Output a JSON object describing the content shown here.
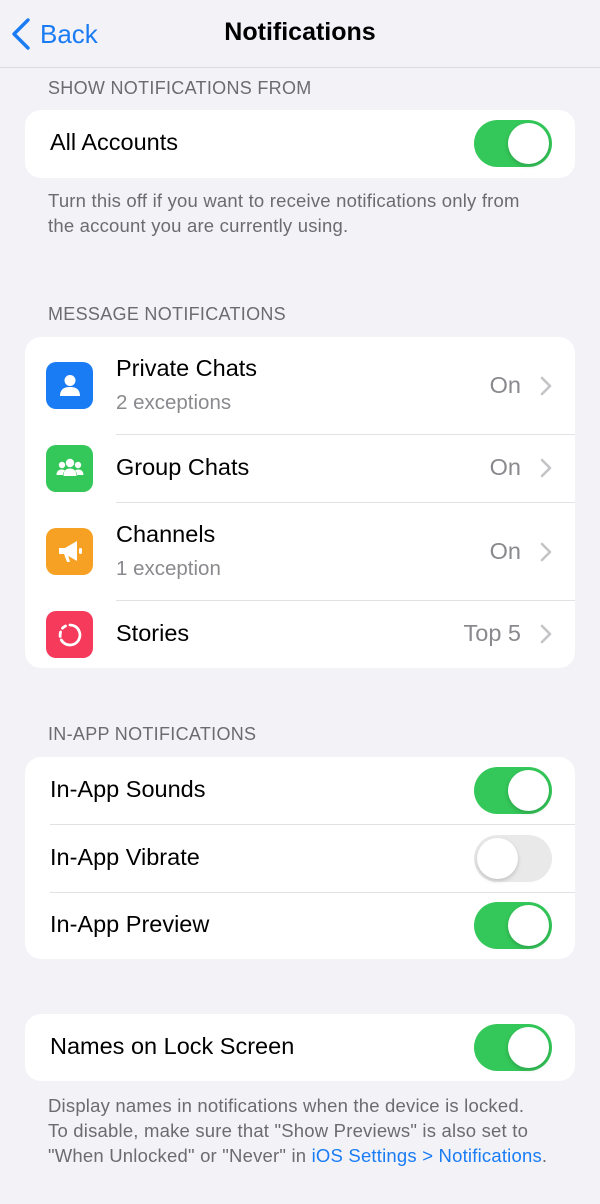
{
  "nav": {
    "back_label": "Back",
    "title": "Notifications"
  },
  "show_from": {
    "header": "SHOW NOTIFICATIONS FROM",
    "all_accounts": {
      "label": "All Accounts",
      "enabled": true
    },
    "footer": "Turn this off if you want to receive notifications only from the account you are currently using."
  },
  "message": {
    "header": "MESSAGE NOTIFICATIONS",
    "items": [
      {
        "title": "Private Chats",
        "subtitle": "2 exceptions",
        "value": "On",
        "icon": "person-icon",
        "color": "#1a7cf5"
      },
      {
        "title": "Group Chats",
        "subtitle": "",
        "value": "On",
        "icon": "group-icon",
        "color": "#34c759"
      },
      {
        "title": "Channels",
        "subtitle": "1 exception",
        "value": "On",
        "icon": "megaphone-icon",
        "color": "#f6a024"
      },
      {
        "title": "Stories",
        "subtitle": "",
        "value": "Top 5",
        "icon": "stories-icon",
        "color": "#f53a5b"
      }
    ]
  },
  "inapp": {
    "header": "IN-APP NOTIFICATIONS",
    "items": [
      {
        "label": "In-App Sounds",
        "enabled": true
      },
      {
        "label": "In-App Vibrate",
        "enabled": false
      },
      {
        "label": "In-App Preview",
        "enabled": true
      }
    ]
  },
  "lock": {
    "label": "Names on Lock Screen",
    "enabled": true,
    "footer_text": "Display names in notifications when the device is locked. To disable, make sure that \"Show Previews\" is also set to \"When Unlocked\" or \"Never\" in ",
    "footer_link": "iOS Settings > Notifications",
    "footer_end": "."
  },
  "colors": {
    "accent": "#1a7cf5",
    "toggle_on": "#34c759",
    "toggle_off": "#e9e9ea"
  }
}
